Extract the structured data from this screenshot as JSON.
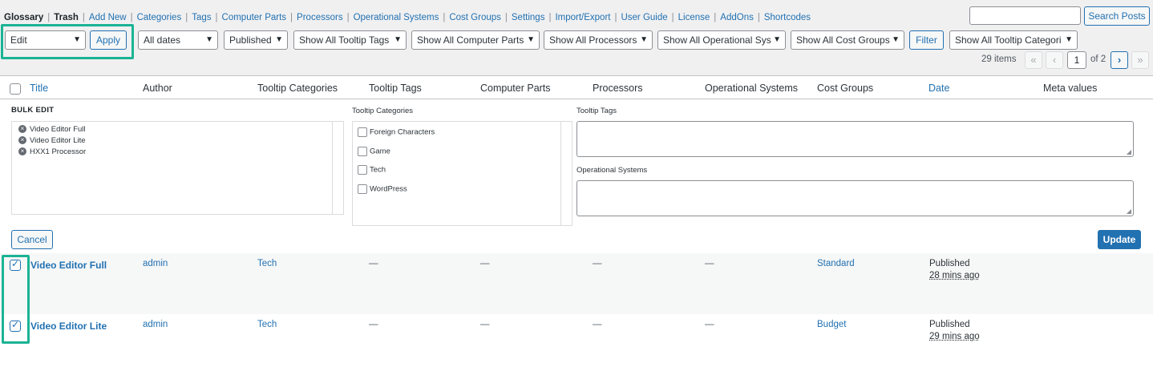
{
  "nav": {
    "current": "Glossary",
    "items": [
      "Trash",
      "Add New",
      "Categories",
      "Tags",
      "Computer Parts",
      "Processors",
      "Operational Systems",
      "Cost Groups",
      "Settings",
      "Import/Export",
      "User Guide",
      "License",
      "AddOns",
      "Shortcodes"
    ]
  },
  "search": {
    "button": "Search Posts",
    "value": ""
  },
  "toolbar": {
    "bulk_action": "Edit",
    "apply": "Apply",
    "filters": [
      "All dates",
      "Published",
      "Show All Tooltip Tags",
      "Show All Computer Parts",
      "Show All Processors",
      "Show All Operational Sys",
      "Show All Cost Groups"
    ],
    "filter_button": "Filter",
    "tooltip_categories_filter": "Show All Tooltip Categori"
  },
  "pagination": {
    "items": "29 items",
    "first": "«",
    "prev": "‹",
    "current": "1",
    "of": "of 2",
    "next": "›",
    "last": "»"
  },
  "columns": [
    "Title",
    "Author",
    "Tooltip Categories",
    "Tooltip Tags",
    "Computer Parts",
    "Processors",
    "Operational Systems",
    "Cost Groups",
    "Date",
    "Meta values"
  ],
  "bulk_edit": {
    "heading": "BULK EDIT",
    "posts": [
      "Video Editor Full",
      "Video Editor Lite",
      "HXX1 Processor"
    ],
    "categories_label": "Tooltip Categories",
    "categories": [
      "Foreign Characters",
      "Game",
      "Tech",
      "WordPress"
    ],
    "tags_label": "Tooltip Tags",
    "os_label": "Operational Systems",
    "cancel": "Cancel",
    "update": "Update"
  },
  "rows": [
    {
      "title": "Video Editor Full",
      "author": "admin",
      "category": "Tech",
      "tags": "—",
      "parts": "—",
      "processors": "—",
      "os": "—",
      "cost_group": "Standard",
      "status": "Published",
      "ago": "28 mins ago",
      "checked": true
    },
    {
      "title": "Video Editor Lite",
      "author": "admin",
      "category": "Tech",
      "tags": "—",
      "parts": "—",
      "processors": "—",
      "os": "—",
      "cost_group": "Budget",
      "status": "Published",
      "ago": "29 mins ago",
      "checked": true
    }
  ],
  "colors": {
    "accent": "#2271b1",
    "highlight": "#1bb394"
  }
}
